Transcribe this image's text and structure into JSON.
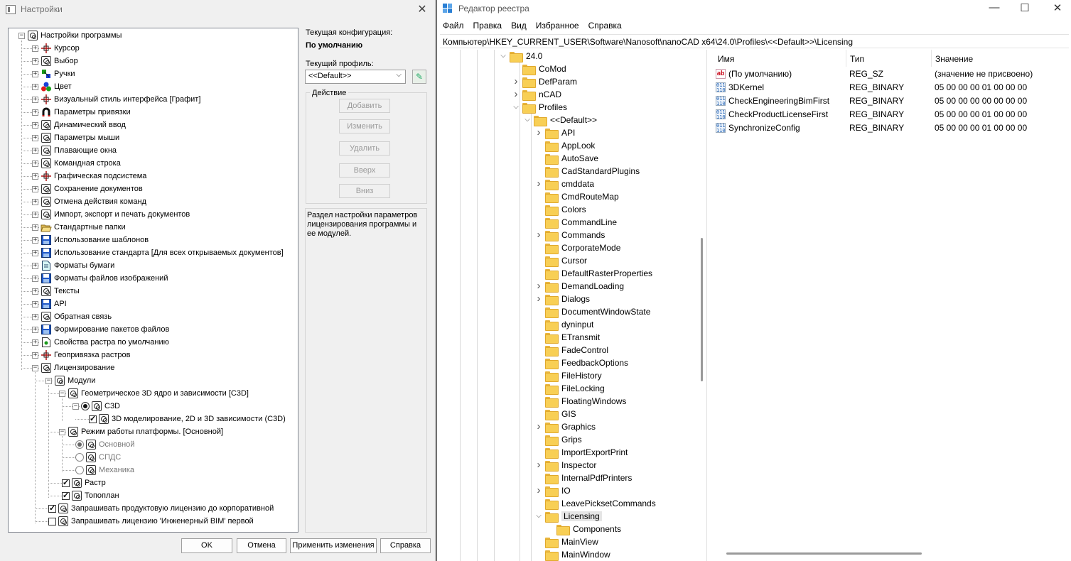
{
  "settings": {
    "title": "Настройки",
    "close_glyph": "✕",
    "tree": [
      {
        "label": "Настройки программы",
        "icon": "gear-icon"
      },
      {
        "label": "Курсор",
        "icon": "cursor-icon"
      },
      {
        "label": "Выбор",
        "icon": "gear-icon"
      },
      {
        "label": "Ручки",
        "icon": "grips-icon"
      },
      {
        "label": "Цвет",
        "icon": "color-icon"
      },
      {
        "label": "Визуальный стиль интерфейса [Графит]",
        "icon": "cursor-icon"
      },
      {
        "label": "Параметры привязки",
        "icon": "magnet-icon"
      },
      {
        "label": "Динамический ввод",
        "icon": "gear-icon"
      },
      {
        "label": "Параметры мыши",
        "icon": "gear-icon"
      },
      {
        "label": "Плавающие окна",
        "icon": "gear-icon"
      },
      {
        "label": "Командная строка",
        "icon": "gear-icon"
      },
      {
        "label": "Графическая подсистема",
        "icon": "cursor-icon"
      },
      {
        "label": "Сохранение документов",
        "icon": "gear-icon"
      },
      {
        "label": "Отмена действия команд",
        "icon": "gear-icon"
      },
      {
        "label": "Импорт, экспорт и печать документов",
        "icon": "gear-icon"
      },
      {
        "label": "Стандартные папки",
        "icon": "open-folder-icon"
      },
      {
        "label": "Использование шаблонов",
        "icon": "save-icon"
      },
      {
        "label": "Использование стандарта [Для всех открываемых документов]",
        "icon": "save-icon"
      },
      {
        "label": "Форматы бумаги",
        "icon": "document-icon"
      },
      {
        "label": "Форматы файлов изображений",
        "icon": "save-icon"
      },
      {
        "label": "Тексты",
        "icon": "gear-icon"
      },
      {
        "label": "API",
        "icon": "save-icon"
      },
      {
        "label": "Обратная связь",
        "icon": "gear-icon"
      },
      {
        "label": "Формирование пакетов файлов",
        "icon": "save-icon"
      },
      {
        "label": "Свойства растра по умолчанию",
        "icon": "raster-icon"
      },
      {
        "label": "Геопривязка растров",
        "icon": "cursor-icon"
      },
      {
        "label": "Лицензирование",
        "icon": "gear-icon"
      },
      {
        "label": "Модули",
        "icon": "gear-icon"
      },
      {
        "label": "Геометрическое 3D ядро и зависимости [C3D]",
        "icon": "gear-icon"
      },
      {
        "label": "C3D",
        "icon": "gear-icon"
      },
      {
        "label": "3D моделирование, 2D и 3D зависимости (C3D)",
        "icon": "gear-icon"
      },
      {
        "label": "Режим работы платформы. [Основной]",
        "icon": "gear-icon"
      },
      {
        "label": "Основной",
        "icon": "gear-icon"
      },
      {
        "label": "СПДС",
        "icon": "gear-icon"
      },
      {
        "label": "Механика",
        "icon": "gear-icon"
      },
      {
        "label": "Растр",
        "icon": "gear-icon"
      },
      {
        "label": "Топоплан",
        "icon": "gear-icon"
      },
      {
        "label": "Запрашивать продуктовую лицензию до корпоративной",
        "icon": "gear-icon"
      },
      {
        "label": "Запрашивать лицензию 'Инженерный BIM' первой",
        "icon": "gear-icon"
      }
    ],
    "config_label": "Текущая конфигурация:",
    "config_value": "По умолчанию",
    "profile_label": "Текущий профиль:",
    "profile_value": "<<Default>>",
    "action_group_label": "Действие",
    "action_buttons": {
      "add": "Добавить",
      "edit": "Изменить",
      "delete": "Удалить",
      "up": "Вверх",
      "down": "Вниз"
    },
    "description": "Раздел настройки параметров лицензирования программы и ее модулей.",
    "dialog_buttons": {
      "ok": "OK",
      "cancel": "Отмена",
      "apply": "Применить изменения",
      "help": "Справка"
    }
  },
  "registry": {
    "title": "Редактор реестра",
    "controls": {
      "minimize": "—",
      "maximize": "☐",
      "close": "✕"
    },
    "menu": [
      "Файл",
      "Правка",
      "Вид",
      "Избранное",
      "Справка"
    ],
    "address": "Компьютер\\HKEY_CURRENT_USER\\Software\\Nanosoft\\nanoCAD x64\\24.0\\Profiles\\<<Default>>\\Licensing",
    "tree": [
      {
        "label": "24.0"
      },
      {
        "label": "CoMod"
      },
      {
        "label": "DefParam"
      },
      {
        "label": "nCAD"
      },
      {
        "label": "Profiles"
      },
      {
        "label": "<<Default>>"
      },
      {
        "label": "API"
      },
      {
        "label": "AppLook"
      },
      {
        "label": "AutoSave"
      },
      {
        "label": "CadStandardPlugins"
      },
      {
        "label": "cmddata"
      },
      {
        "label": "CmdRouteMap"
      },
      {
        "label": "Colors"
      },
      {
        "label": "CommandLine"
      },
      {
        "label": "Commands"
      },
      {
        "label": "CorporateMode"
      },
      {
        "label": "Cursor"
      },
      {
        "label": "DefaultRasterProperties"
      },
      {
        "label": "DemandLoading"
      },
      {
        "label": "Dialogs"
      },
      {
        "label": "DocumentWindowState"
      },
      {
        "label": "dyninput"
      },
      {
        "label": "ETransmit"
      },
      {
        "label": "FadeControl"
      },
      {
        "label": "FeedbackOptions"
      },
      {
        "label": "FileHistory"
      },
      {
        "label": "FileLocking"
      },
      {
        "label": "FloatingWindows"
      },
      {
        "label": "GIS"
      },
      {
        "label": "Graphics"
      },
      {
        "label": "Grips"
      },
      {
        "label": "ImportExportPrint"
      },
      {
        "label": "Inspector"
      },
      {
        "label": "InternalPdfPrinters"
      },
      {
        "label": "IO"
      },
      {
        "label": "LeavePicksetCommands"
      },
      {
        "label": "Licensing"
      },
      {
        "label": "Components"
      },
      {
        "label": "MainView"
      },
      {
        "label": "MainWindow"
      }
    ],
    "columns": {
      "name": "Имя",
      "type": "Тип",
      "value": "Значение"
    },
    "values": [
      {
        "name": "(По умолчанию)",
        "type": "REG_SZ",
        "data": "(значение не присвоено)",
        "icon": "string-value-icon",
        "glyph": "ab"
      },
      {
        "name": "3DKernel",
        "type": "REG_BINARY",
        "data": "05 00 00 00 01 00 00 00",
        "icon": "binary-value-icon",
        "glyph": "011\n110"
      },
      {
        "name": "CheckEngineeringBimFirst",
        "type": "REG_BINARY",
        "data": "05 00 00 00 00 00 00 00",
        "icon": "binary-value-icon",
        "glyph": "011\n110"
      },
      {
        "name": "CheckProductLicenseFirst",
        "type": "REG_BINARY",
        "data": "05 00 00 00 01 00 00 00",
        "icon": "binary-value-icon",
        "glyph": "011\n110"
      },
      {
        "name": "SynchronizeConfig",
        "type": "REG_BINARY",
        "data": "05 00 00 00 01 00 00 00",
        "icon": "binary-value-icon",
        "glyph": "011\n110"
      }
    ]
  }
}
